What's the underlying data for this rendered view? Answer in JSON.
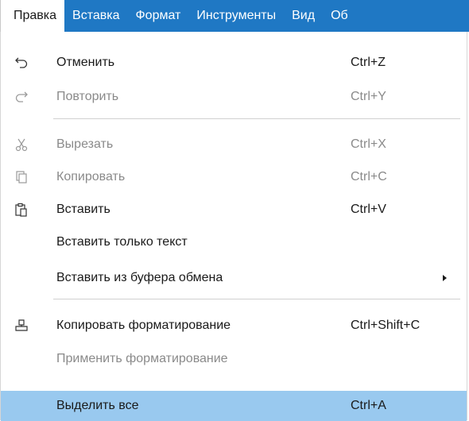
{
  "menubar": {
    "items": [
      {
        "label": "Правка"
      },
      {
        "label": "Вставка"
      },
      {
        "label": "Формат"
      },
      {
        "label": "Инструменты"
      },
      {
        "label": "Вид"
      },
      {
        "label": "Об"
      }
    ]
  },
  "menu": {
    "undo": {
      "label": "Отменить",
      "shortcut": "Ctrl+Z"
    },
    "redo": {
      "label": "Повторить",
      "shortcut": "Ctrl+Y"
    },
    "cut": {
      "label": "Вырезать",
      "shortcut": "Ctrl+X"
    },
    "copy": {
      "label": "Копировать",
      "shortcut": "Ctrl+C"
    },
    "paste": {
      "label": "Вставить",
      "shortcut": "Ctrl+V"
    },
    "paste_text": {
      "label": "Вставить только текст"
    },
    "paste_from_clipboard": {
      "label": "Вставить из буфера обмена"
    },
    "copy_format": {
      "label": "Копировать форматирование",
      "shortcut": "Ctrl+Shift+C"
    },
    "apply_format": {
      "label": "Применить форматирование"
    },
    "select_all": {
      "label": "Выделить все",
      "shortcut": "Ctrl+A"
    }
  },
  "colors": {
    "menubar_bg": "#1f78c4",
    "highlight": "#99c9ef",
    "disabled_text": "#8a8a8a"
  }
}
